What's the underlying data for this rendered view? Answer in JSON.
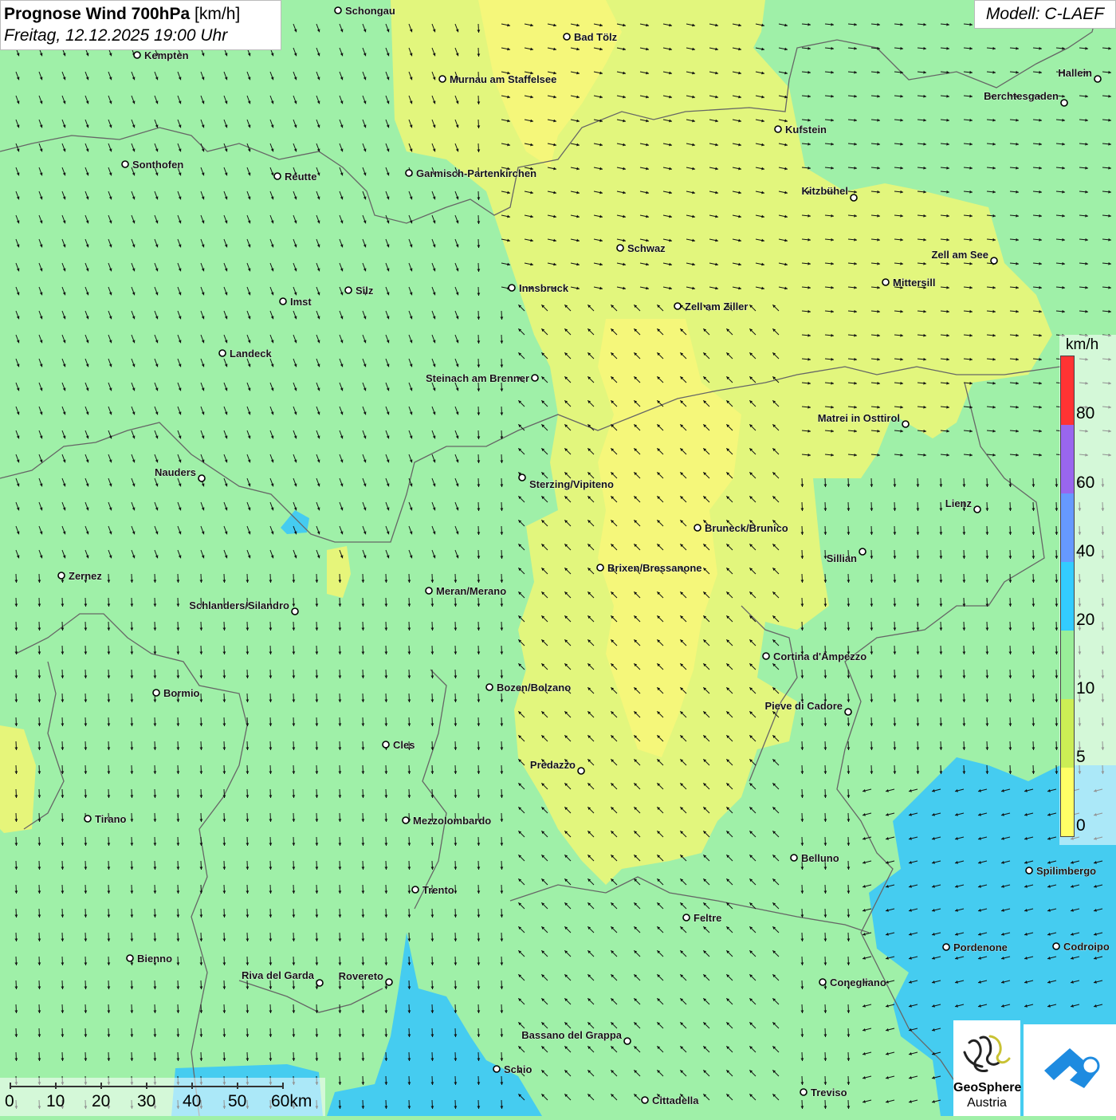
{
  "header": {
    "title_bold": "Prognose Wind 700hPa",
    "title_unit": "[km/h]",
    "subtitle": "Freitag, 12.12.2025 19:00 Uhr",
    "model": "Modell: C-LAEF"
  },
  "legend": {
    "unit": "km/h",
    "ticks": [
      "80",
      "60",
      "40",
      "20",
      "10",
      "5",
      "0"
    ],
    "colors": [
      "#ff3333",
      "#9966ee",
      "#6699ff",
      "#33ccff",
      "#99ee99",
      "#ccee55",
      "#ffff66"
    ]
  },
  "scale_bar": {
    "labels": [
      "0",
      "10",
      "20",
      "30",
      "40",
      "50",
      "60km"
    ]
  },
  "logo": {
    "line1": "GeoSphere",
    "line2": "Austria"
  },
  "cities": [
    {
      "name": "Schongau"
    },
    {
      "name": "Kempten"
    },
    {
      "name": "Bad Tölz"
    },
    {
      "name": "Murnau am Staffelsee"
    },
    {
      "name": "Hallein"
    },
    {
      "name": "Berchtesgaden"
    },
    {
      "name": "Kufstein"
    },
    {
      "name": "Sonthofen"
    },
    {
      "name": "Reutte"
    },
    {
      "name": "Garmisch-Partenkirchen"
    },
    {
      "name": "Kitzbühel"
    },
    {
      "name": "Schwaz"
    },
    {
      "name": "Zell am See"
    },
    {
      "name": "Mittersill"
    },
    {
      "name": "Silz"
    },
    {
      "name": "Innsbruck"
    },
    {
      "name": "Imst"
    },
    {
      "name": "Zell am Ziller"
    },
    {
      "name": "Landeck"
    },
    {
      "name": "Steinach am Brenner"
    },
    {
      "name": "Matrei in Osttirol"
    },
    {
      "name": "Nauders"
    },
    {
      "name": "Sterzing/Vipiteno"
    },
    {
      "name": "Lienz"
    },
    {
      "name": "Bruneck/Brunico"
    },
    {
      "name": "Sillian"
    },
    {
      "name": "Brixen/Bressanone"
    },
    {
      "name": "Zernez"
    },
    {
      "name": "Meran/Merano"
    },
    {
      "name": "Schlanders/Silandro"
    },
    {
      "name": "Cortina d'Ampezzo"
    },
    {
      "name": "Bozen/Bolzano"
    },
    {
      "name": "Bormio"
    },
    {
      "name": "Pieve di Cadore"
    },
    {
      "name": "Cles"
    },
    {
      "name": "Predazzo"
    },
    {
      "name": "Tirano"
    },
    {
      "name": "Mezzolombardo"
    },
    {
      "name": "Belluno"
    },
    {
      "name": "Spilimbergo"
    },
    {
      "name": "Trento"
    },
    {
      "name": "Feltre"
    },
    {
      "name": "Pordenone"
    },
    {
      "name": "Codroipo"
    },
    {
      "name": "Bienno"
    },
    {
      "name": "Riva del Garda"
    },
    {
      "name": "Rovereto"
    },
    {
      "name": "Conegliano"
    },
    {
      "name": "Bassano del Grappa"
    },
    {
      "name": "Schio"
    },
    {
      "name": "Treviso"
    },
    {
      "name": "Cittadella"
    }
  ]
}
